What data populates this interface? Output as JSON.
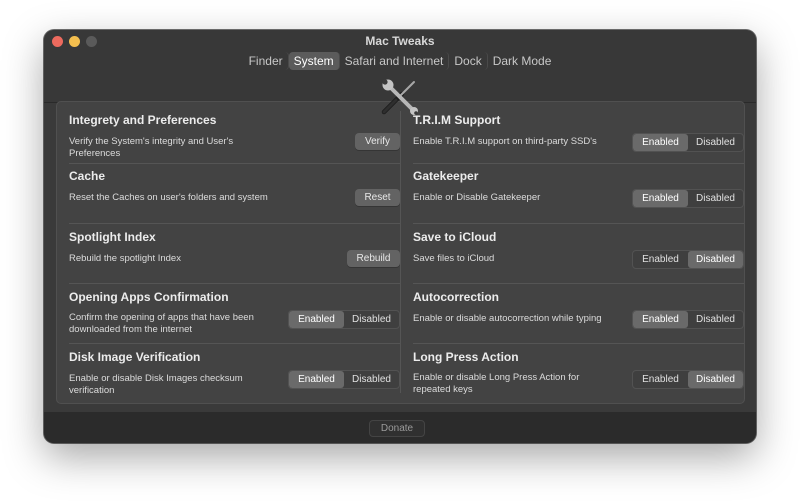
{
  "window": {
    "title": "Mac Tweaks"
  },
  "tabs": [
    {
      "label": "Finder"
    },
    {
      "label": "System"
    },
    {
      "label": "Safari and Internet"
    },
    {
      "label": "Dock"
    },
    {
      "label": "Dark Mode"
    }
  ],
  "active_tab": "System",
  "left": [
    {
      "title": "Integrety and Preferences",
      "desc": "Verify the System's integrity and User's Preferences",
      "control": "button",
      "button_label": "Verify"
    },
    {
      "title": "Cache",
      "desc": "Reset the Caches on user's folders and system",
      "control": "button",
      "button_label": "Reset"
    },
    {
      "title": "Spotlight Index",
      "desc": "Rebuild the spotlight Index",
      "control": "button",
      "button_label": "Rebuild"
    },
    {
      "title": "Opening Apps Confirmation",
      "desc": "Confirm the opening of apps that have been downloaded from the internet",
      "control": "toggle",
      "options": [
        "Enabled",
        "Disabled"
      ],
      "selected": "Enabled"
    },
    {
      "title": "Disk Image Verification",
      "desc": "Enable or disable Disk Images checksum verification",
      "control": "toggle",
      "options": [
        "Enabled",
        "Disabled"
      ],
      "selected": "Enabled"
    }
  ],
  "right": [
    {
      "title": "T.R.I.M Support",
      "desc": "Enable T.R.I.M support on third-party SSD's",
      "control": "toggle",
      "options": [
        "Enabled",
        "Disabled"
      ],
      "selected": "Enabled"
    },
    {
      "title": "Gatekeeper",
      "desc": "Enable or Disable Gatekeeper",
      "control": "toggle",
      "options": [
        "Enabled",
        "Disabled"
      ],
      "selected": "Enabled"
    },
    {
      "title": "Save to iCloud",
      "desc": "Save files to iCloud",
      "control": "toggle",
      "options": [
        "Enabled",
        "Disabled"
      ],
      "selected": "Disabled"
    },
    {
      "title": "Autocorrection",
      "desc": "Enable or disable autocorrection while typing",
      "control": "toggle",
      "options": [
        "Enabled",
        "Disabled"
      ],
      "selected": "Enabled"
    },
    {
      "title": "Long Press Action",
      "desc": "Enable or disable Long Press Action for repeated keys",
      "control": "toggle",
      "options": [
        "Enabled",
        "Disabled"
      ],
      "selected": "Disabled"
    }
  ],
  "footer": {
    "donate_label": "Donate"
  },
  "icons": {
    "header": "tools-icon"
  },
  "colors": {
    "window_bg": "#3a3a3a",
    "panel_bg": "#434343",
    "selected_segment": "#6a6a6a",
    "close": "#ed6a5e",
    "minimize": "#f4bf4f"
  }
}
